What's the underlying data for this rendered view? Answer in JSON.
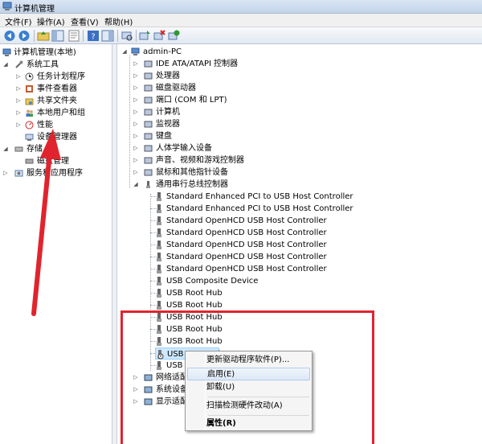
{
  "window": {
    "title": "计算机管理"
  },
  "menu": [
    {
      "label": "文件(F)"
    },
    {
      "label": "操作(A)"
    },
    {
      "label": "查看(V)"
    },
    {
      "label": "帮助(H)"
    }
  ],
  "toolbar": {
    "icons": [
      "back-icon",
      "forward-icon",
      "up-folder-icon",
      "show-tree-icon",
      "properties-icon",
      "help-icon",
      "console-icon",
      "scan-hardware-icon",
      "uninstall-icon",
      "enable-icon"
    ]
  },
  "left_tree": {
    "root": "计算机管理(本地)",
    "system_tools": "系统工具",
    "items": [
      {
        "label": "任务计划程序"
      },
      {
        "label": "事件查看器"
      },
      {
        "label": "共享文件夹"
      },
      {
        "label": "本地用户和组"
      },
      {
        "label": "性能"
      },
      {
        "label": "设备管理器"
      }
    ],
    "storage": "存储",
    "disk_mgmt": "磁盘管理",
    "services": "服务和应用程序"
  },
  "device_tree": {
    "root": "admin-PC",
    "categories_top": [
      {
        "label": "IDE ATA/ATAPI 控制器"
      },
      {
        "label": "处理器"
      },
      {
        "label": "磁盘驱动器"
      },
      {
        "label": "端口 (COM 和 LPT)"
      },
      {
        "label": "计算机"
      },
      {
        "label": "监视器"
      },
      {
        "label": "键盘"
      },
      {
        "label": "人体学输入设备"
      },
      {
        "label": "声音、视频和游戏控制器"
      },
      {
        "label": "鼠标和其他指针设备"
      }
    ],
    "usb_category": "通用串行总线控制器",
    "usb_devices": [
      {
        "label": "Standard Enhanced PCI to USB Host Controller"
      },
      {
        "label": "Standard Enhanced PCI to USB Host Controller"
      },
      {
        "label": "Standard OpenHCD USB Host Controller"
      },
      {
        "label": "Standard OpenHCD USB Host Controller"
      },
      {
        "label": "Standard OpenHCD USB Host Controller"
      },
      {
        "label": "Standard OpenHCD USB Host Controller"
      },
      {
        "label": "Standard OpenHCD USB Host Controller"
      },
      {
        "label": "USB Composite Device"
      },
      {
        "label": "USB Root Hub"
      },
      {
        "label": "USB Root Hub"
      },
      {
        "label": "USB Root Hub"
      },
      {
        "label": "USB Root Hub"
      },
      {
        "label": "USB Root Hub"
      },
      {
        "label": "USB Root Hub"
      },
      {
        "label": "USB Root Hub"
      }
    ],
    "categories_bottom": [
      {
        "label": "网络适配器"
      },
      {
        "label": "系统设备"
      },
      {
        "label": "显示适配器"
      }
    ]
  },
  "context_menu": {
    "items": [
      {
        "label": "更新驱动程序软件(P)..."
      },
      {
        "label": "启用(E)"
      },
      {
        "label": "卸载(U)"
      },
      {
        "label": "扫描检测硬件改动(A)"
      },
      {
        "label": "属性(R)"
      }
    ]
  },
  "colors": {
    "annotation_red": "#e0242e",
    "selection": "#cde8ff"
  }
}
